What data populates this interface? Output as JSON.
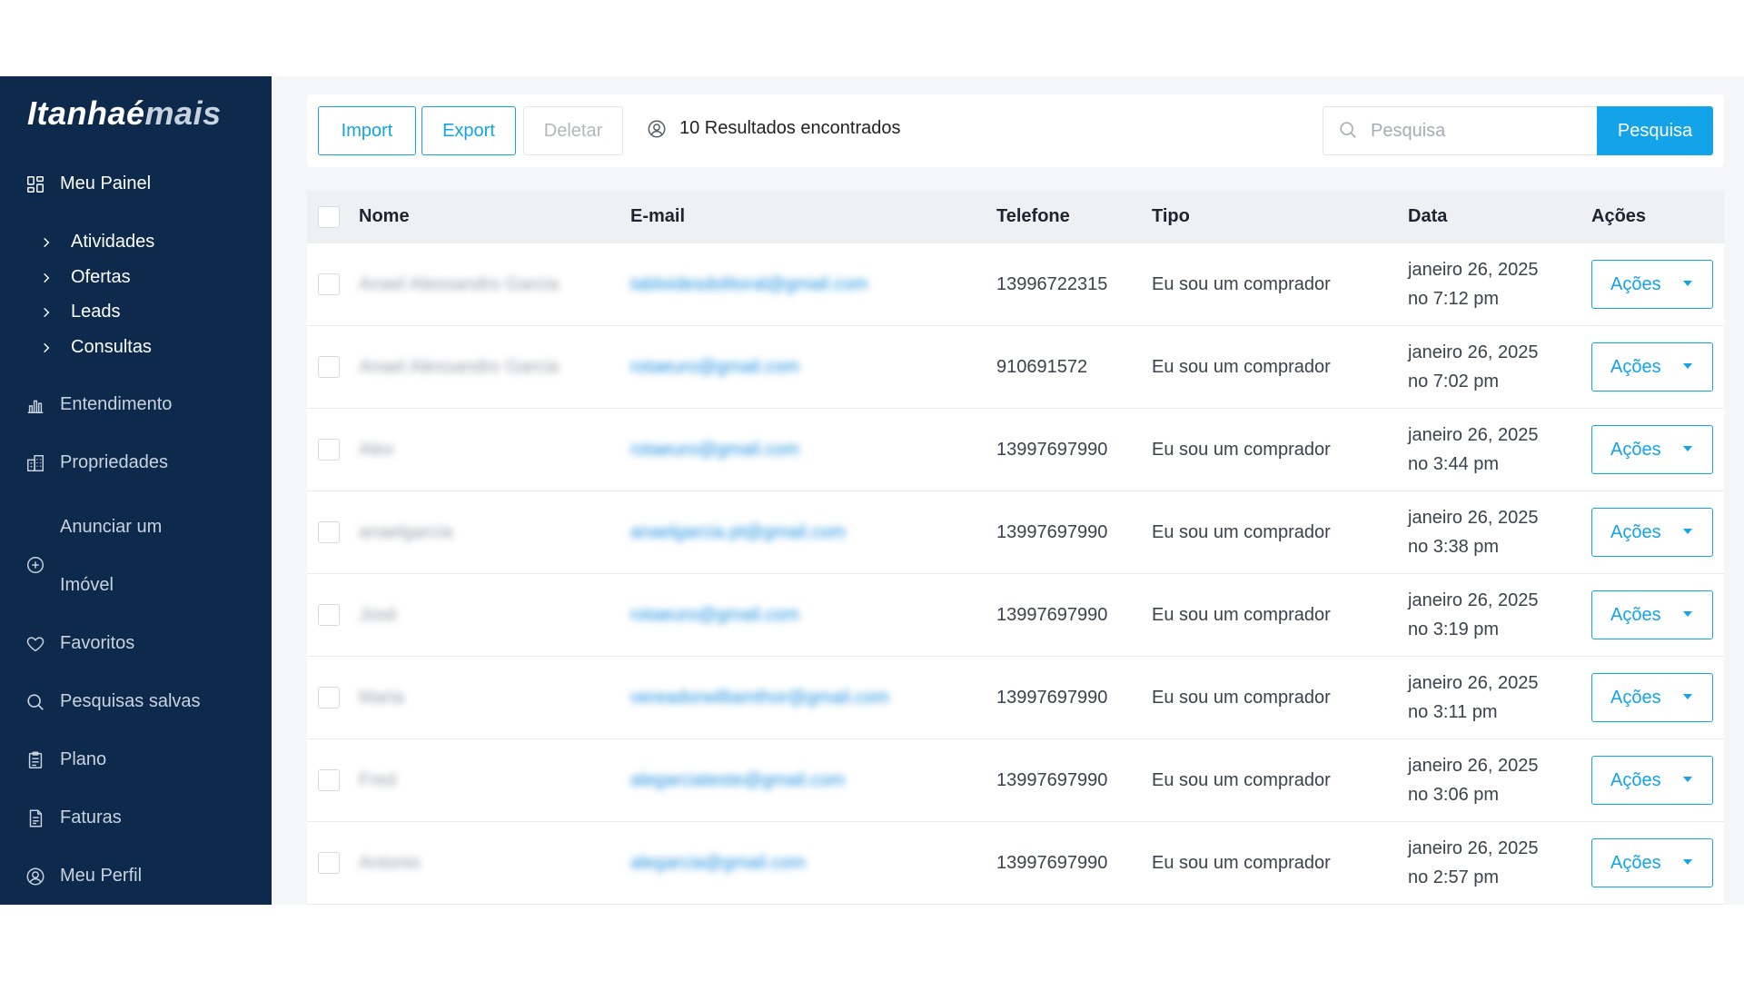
{
  "app": {
    "brand_main": "Itanhaé",
    "brand_accent": "mais"
  },
  "sidebar": {
    "dashboard": {
      "label": "Meu Painel",
      "icon": "dashboard-icon"
    },
    "submenu": [
      {
        "label": "Atividades"
      },
      {
        "label": "Ofertas"
      },
      {
        "label": "Leads"
      },
      {
        "label": "Consultas"
      }
    ],
    "items": [
      {
        "label": "Entendimento",
        "icon": "bar-chart-icon"
      },
      {
        "label": "Propriedades",
        "icon": "buildings-icon"
      }
    ],
    "anunciar": {
      "line1": "Anunciar um",
      "line2": "Imóvel",
      "icon": "plus-circle-icon"
    },
    "items2": [
      {
        "label": "Favoritos",
        "icon": "heart-icon"
      },
      {
        "label": "Pesquisas salvas",
        "icon": "search-icon"
      },
      {
        "label": "Plano",
        "icon": "clipboard-icon"
      },
      {
        "label": "Faturas",
        "icon": "invoice-icon"
      },
      {
        "label": "Meu Perfil",
        "icon": "user-circle-icon"
      }
    ]
  },
  "toolbar": {
    "import_label": "Import",
    "export_label": "Export",
    "delete_label": "Deletar",
    "results_text": "10 Resultados encontrados",
    "search_placeholder": "Pesquisa",
    "search_button": "Pesquisa"
  },
  "table": {
    "headers": {
      "name": "Nome",
      "email": "E-mail",
      "phone": "Telefone",
      "type": "Tipo",
      "date": "Data",
      "actions": "Ações"
    },
    "rows": [
      {
        "name": "Anael Alessandro Garcia",
        "email": "tabloidesdolitoral@gmail.com",
        "phone": "13996722315",
        "type": "Eu sou um comprador",
        "date1": "janeiro 26, 2025",
        "date2": "no 7:12 pm",
        "action": "Ações"
      },
      {
        "name": "Anael Alessandro Garcia",
        "email": "rotaeuro@gmail.com",
        "phone": "910691572",
        "type": "Eu sou um comprador",
        "date1": "janeiro 26, 2025",
        "date2": "no 7:02 pm",
        "action": "Ações"
      },
      {
        "name": "Alex",
        "email": "rotaeuro@gmail.com",
        "phone": "13997697990",
        "type": "Eu sou um comprador",
        "date1": "janeiro 26, 2025",
        "date2": "no 3:44 pm",
        "action": "Ações"
      },
      {
        "name": "anaelgarcia",
        "email": "anaelgarcia.pt@gmail.com",
        "phone": "13997697990",
        "type": "Eu sou um comprador",
        "date1": "janeiro 26, 2025",
        "date2": "no 3:38 pm",
        "action": "Ações"
      },
      {
        "name": "José",
        "email": "rotaeuro@gmail.com",
        "phone": "13997697990",
        "type": "Eu sou um comprador",
        "date1": "janeiro 26, 2025",
        "date2": "no 3:19 pm",
        "action": "Ações"
      },
      {
        "name": "Maria",
        "email": "vereadorwilliamthor@gmail.com",
        "phone": "13997697990",
        "type": "Eu sou um comprador",
        "date1": "janeiro 26, 2025",
        "date2": "no 3:11 pm",
        "action": "Ações"
      },
      {
        "name": "Fred",
        "email": "alegarciateste@gmail.com",
        "phone": "13997697990",
        "type": "Eu sou um comprador",
        "date1": "janeiro 26, 2025",
        "date2": "no 3:06 pm",
        "action": "Ações"
      },
      {
        "name": "Antonio",
        "email": "alegarcia@gmail.com",
        "phone": "13997697990",
        "type": "Eu sou um comprador",
        "date1": "janeiro 26, 2025",
        "date2": "no 2:57 pm",
        "action": "Ações"
      }
    ]
  },
  "colors": {
    "sidebar_bg": "#0d2a4c",
    "accent": "#12a3e8",
    "page_bg": "#f5f6f8"
  }
}
